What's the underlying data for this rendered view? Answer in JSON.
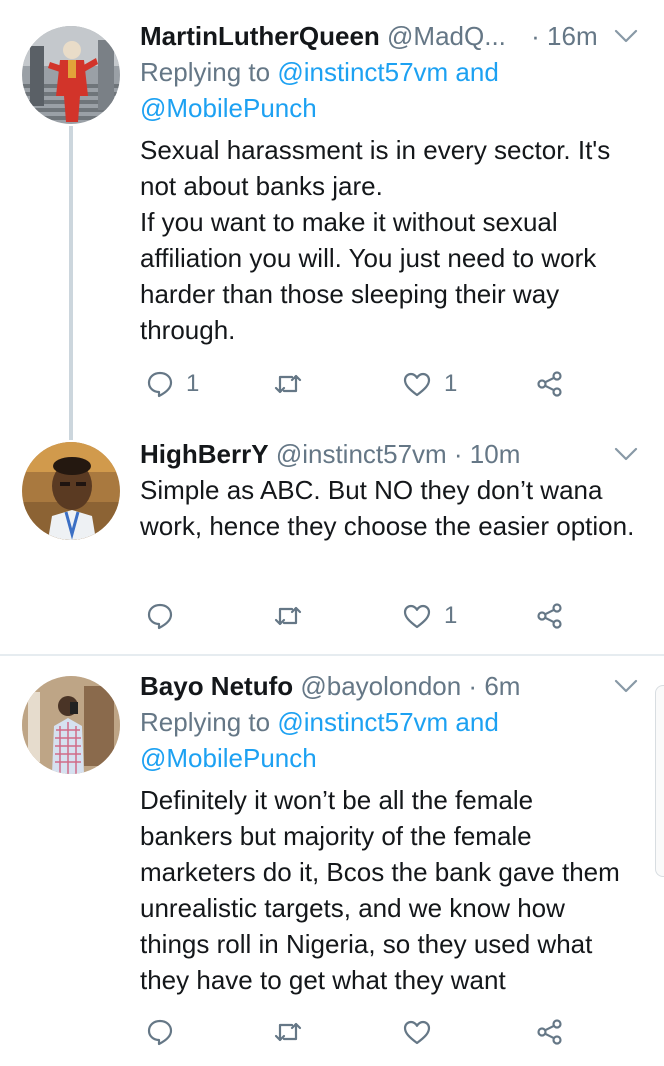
{
  "tweets": [
    {
      "name": "MartinLutherQueen",
      "handle": "@MadQ...",
      "time": "· 16m",
      "reply_prefix": "Replying to ",
      "reply_to_1": "@instinct57vm and",
      "reply_to_2": "@MobilePunch",
      "text": "Sexual harassment is in every sector. It's not about banks jare.\nIf you want to make it without sexual affiliation you will. You just need to work harder than those sleeping their way through.",
      "reply_count": "1",
      "retweet_count": "",
      "like_count": "1"
    },
    {
      "name": "HighBerrY",
      "handle": "@instinct57vm · 10m",
      "text": "Simple as ABC. But NO they don’t wana work, hence they choose the easier option.",
      "reply_count": "",
      "retweet_count": "",
      "like_count": "1"
    },
    {
      "name": "Bayo Netufo",
      "handle": "@bayolondon · 6m",
      "reply_prefix": "Replying to ",
      "reply_to_1": "@instinct57vm and",
      "reply_to_2": "@MobilePunch",
      "text": "Definitely it won’t be all the female bankers but majority of the female marketers do it, Bcos the bank gave them unrealistic targets, and we know how things roll in Nigeria, so they used what they have to get what they want",
      "reply_count": "",
      "retweet_count": "",
      "like_count": ""
    }
  ],
  "icons": {
    "reply": "reply-icon",
    "retweet": "retweet-icon",
    "like": "heart-icon",
    "share": "share-icon",
    "more": "chevron-down-icon"
  },
  "colors": {
    "link": "#1da1f2",
    "muted": "#657786",
    "thread_line": "#ccd6dd"
  }
}
